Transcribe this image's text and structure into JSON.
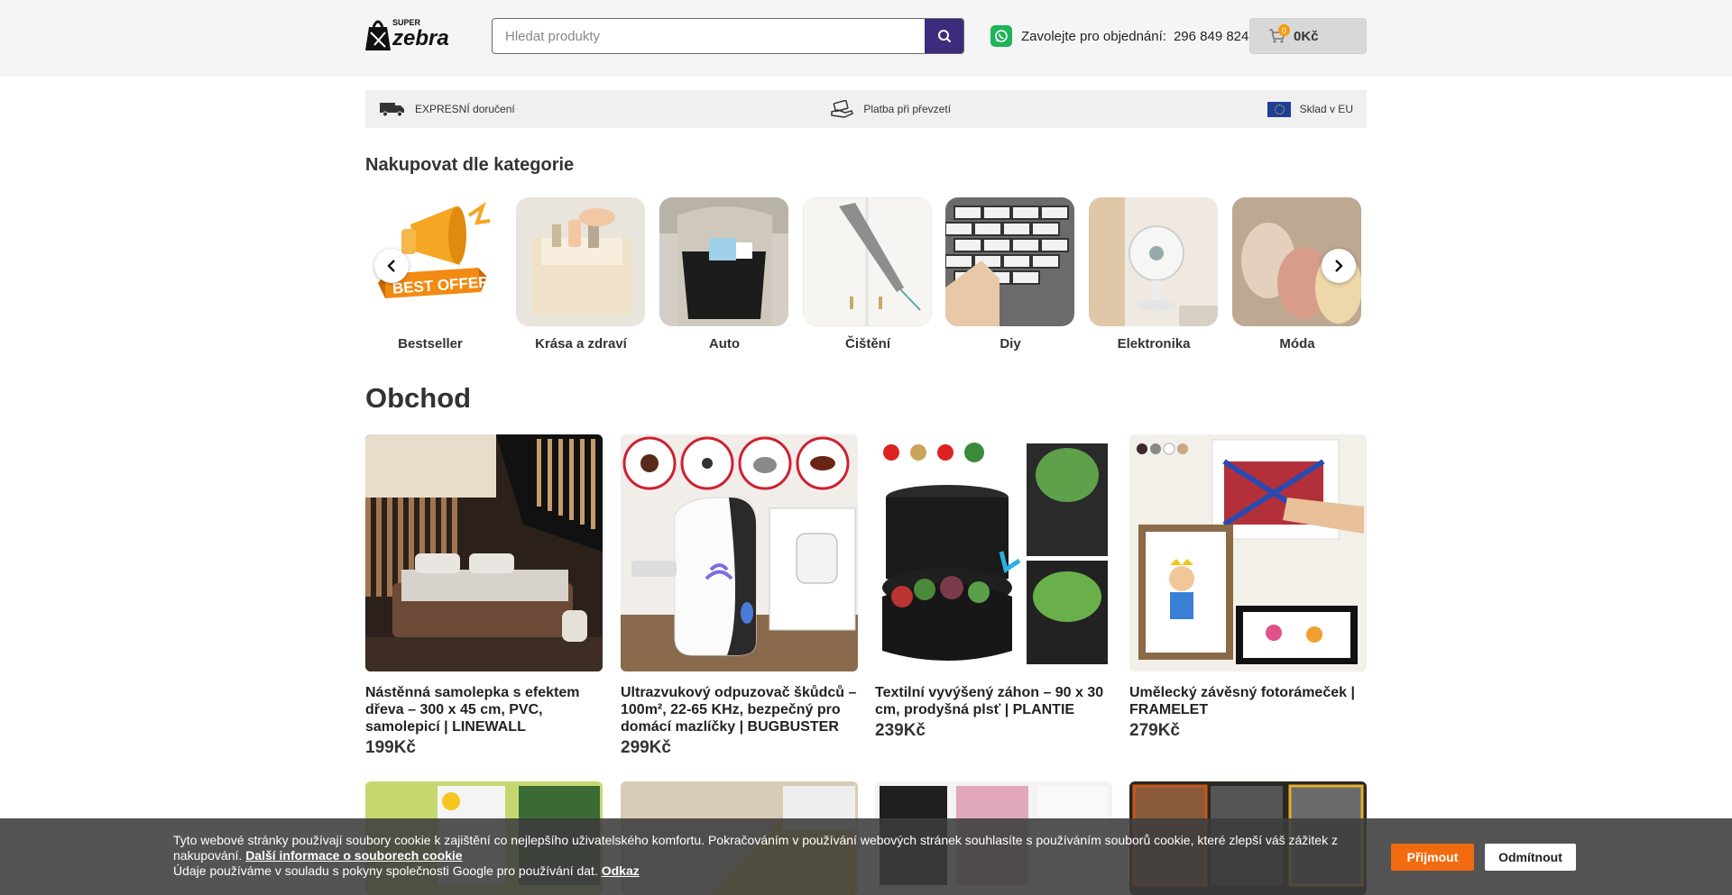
{
  "header": {
    "logo_text_top": "SUPER",
    "logo_text_main": "zebra",
    "search_placeholder": "Hledat produkty",
    "phone_label": "Zavolejte pro objednání:",
    "phone_number": "296 849 824",
    "cart_count": "0",
    "cart_total": "0Kč"
  },
  "benefits": [
    {
      "label": "EXPRESNÍ doručení",
      "icon": "truck-icon"
    },
    {
      "label": "Platba při převzetí",
      "icon": "hand-payment-icon"
    },
    {
      "label": "Sklad v EU",
      "icon": "eu-flag-icon"
    }
  ],
  "categories_title": "Nakupovat dle kategorie",
  "categories": [
    {
      "label": "Bestseller"
    },
    {
      "label": "Krása a zdraví"
    },
    {
      "label": "Auto"
    },
    {
      "label": "Čištění"
    },
    {
      "label": "Diy"
    },
    {
      "label": "Elektronika"
    },
    {
      "label": "Móda"
    }
  ],
  "shop_title": "Obchod",
  "best_offer_text": "BEST OFFER",
  "products": [
    {
      "name": "Nástěnná samolepka s efektem dřeva – 300 x 45 cm, PVC, samolepicí | LINEWALL",
      "price": "199Kč"
    },
    {
      "name": "Ultrazvukový odpuzovač škůdců – 100m², 22-65 KHz, bezpečný pro domácí mazlíčky | BUGBUSTER",
      "price": "299Kč"
    },
    {
      "name": "Textilní vyvýšený záhon – 90 x 30 cm, prodyšná plsť | PLANTIE",
      "price": "239Kč"
    },
    {
      "name": "Umělecký závěsný fotorámeček | FRAMELET",
      "price": "279Kč"
    }
  ],
  "cookie": {
    "text": "Tyto webové stránky používají soubory cookie k zajištění co nejlepšího uživatelského komfortu. Pokračováním v používání webových stránek souhlasíte s používáním souborů cookie, které zlepší váš zážitek z nakupování.",
    "more_link": "Další informace o souborech cookie",
    "google_text": "Údaje používáme v souladu s pokyny společnosti Google pro používání dat.",
    "google_link": "Odkaz",
    "accept": "Přijmout",
    "reject": "Odmítnout"
  },
  "colors": {
    "accent": "#3d2b7e",
    "whatsapp": "#1fb45a",
    "accept_button": "#f26b10"
  }
}
